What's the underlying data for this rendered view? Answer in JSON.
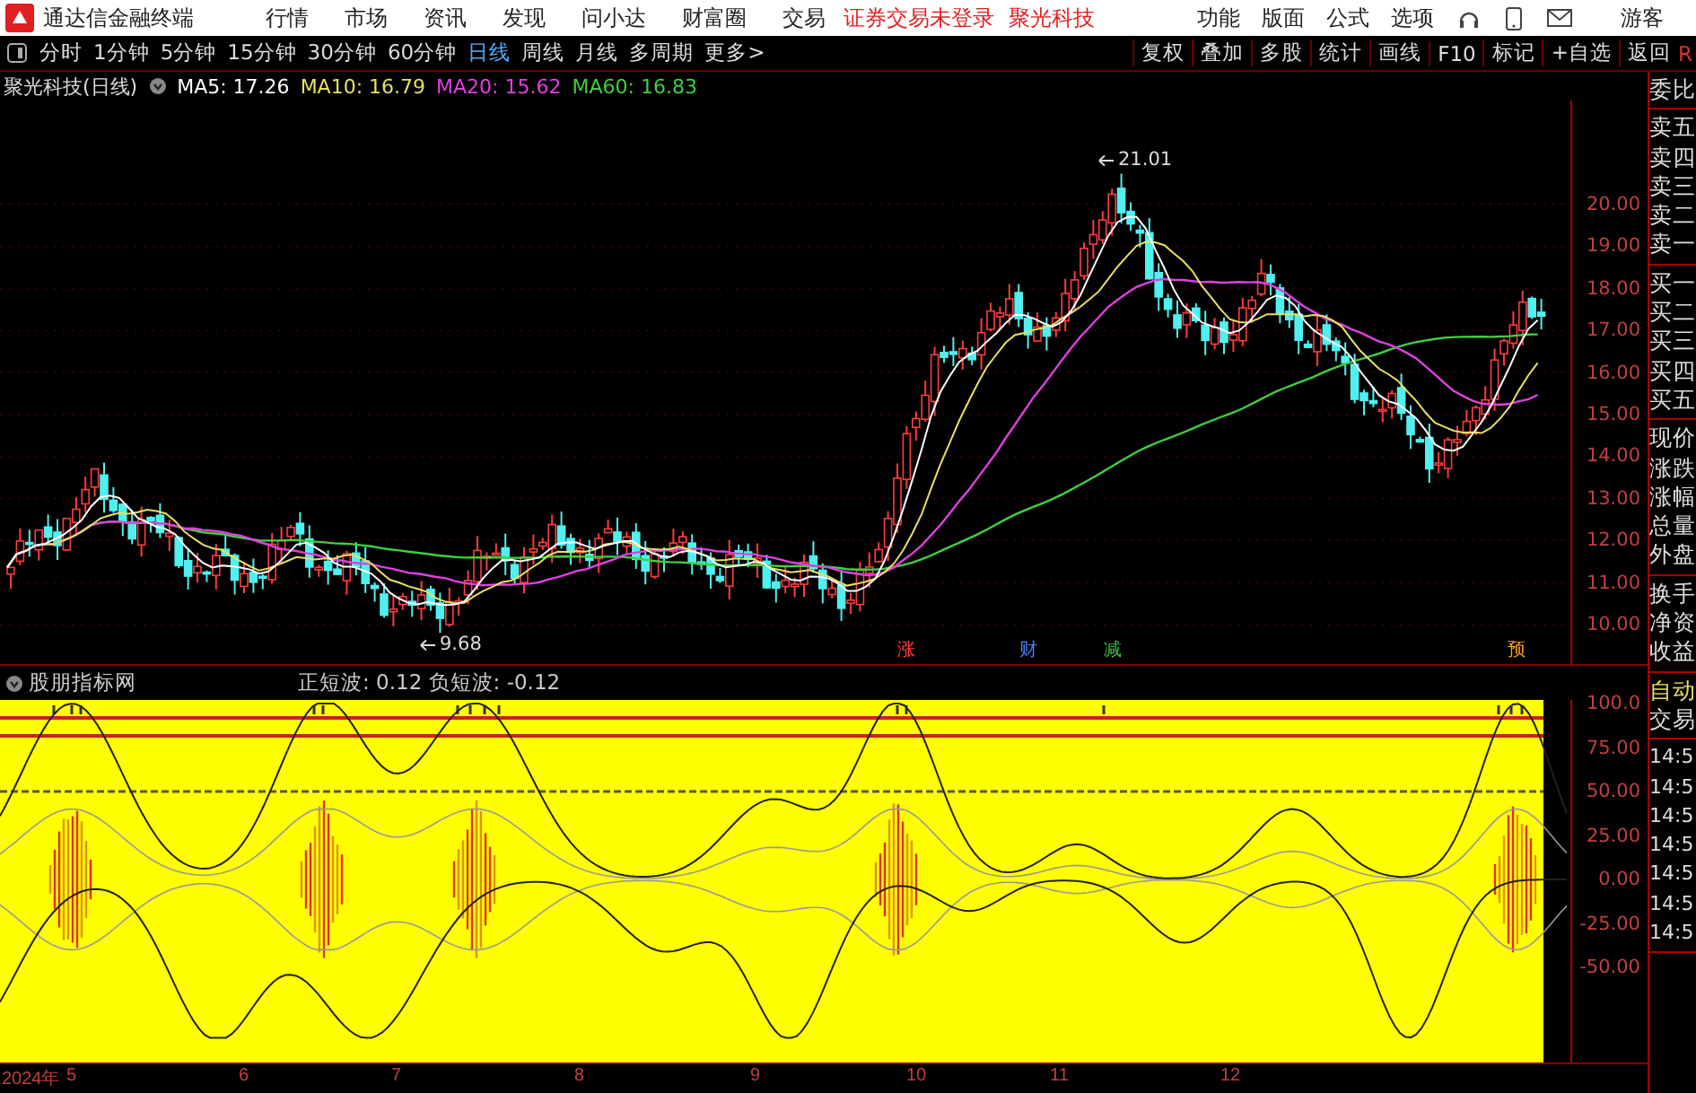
{
  "menu_bar": {
    "app_title": "通达信金融终端",
    "menus": [
      "行情",
      "市场",
      "资讯",
      "发现",
      "问小达",
      "财富圈",
      "交易"
    ],
    "notice": "证券交易未登录",
    "stock": "聚光科技",
    "tools": [
      "功能",
      "版面",
      "公式",
      "选项"
    ],
    "user": "游客"
  },
  "toolbar": {
    "periods": [
      {
        "label": "分时",
        "selected": false
      },
      {
        "label": "1分钟",
        "selected": false
      },
      {
        "label": "5分钟",
        "selected": false
      },
      {
        "label": "15分钟",
        "selected": false
      },
      {
        "label": "30分钟",
        "selected": false
      },
      {
        "label": "60分钟",
        "selected": false
      },
      {
        "label": "日线",
        "selected": true
      },
      {
        "label": "周线",
        "selected": false
      },
      {
        "label": "月线",
        "selected": false
      },
      {
        "label": "多周期",
        "selected": false
      },
      {
        "label": "更多>",
        "selected": false
      }
    ],
    "actions": [
      "复权",
      "叠加",
      "多股",
      "统计",
      "画线",
      "F10",
      "标记",
      "+自选",
      "返回"
    ],
    "edge_label": "R"
  },
  "main_chart": {
    "title": "聚光科技(日线)",
    "averages": [
      {
        "label": "MA5: 17.26",
        "color": "#ffffff"
      },
      {
        "label": "MA10: 16.79",
        "color": "#e8e060"
      },
      {
        "label": "MA20: 15.62",
        "color": "#e040e0"
      },
      {
        "label": "MA60: 16.83",
        "color": "#40d040"
      }
    ],
    "high_label": "21.01",
    "low_label": "9.68",
    "events": [
      {
        "label": "涨",
        "color": "#ff4040"
      },
      {
        "label": "财",
        "color": "#5080ff"
      },
      {
        "label": "减",
        "color": "#40c040"
      },
      {
        "label": "预",
        "color": "#ffa020"
      }
    ],
    "price_ticks": [
      "20.00",
      "19.00",
      "18.00",
      "17.00",
      "16.00",
      "15.00",
      "14.00",
      "13.00",
      "12.00",
      "11.00",
      "10.00"
    ]
  },
  "indicator": {
    "name": "股朋指标网",
    "reading": "正短波: 0.12 负短波: -0.12",
    "ticks": [
      "100.0",
      "75.00",
      "50.00",
      "25.00",
      "0.00",
      "-25.00",
      "-50.00"
    ]
  },
  "date_axis": {
    "labels": [
      "2024年",
      "5",
      "6",
      "7",
      "8",
      "9",
      "10",
      "11",
      "12"
    ]
  },
  "side_panel": {
    "groups": [
      [
        "委比"
      ],
      [
        "卖五",
        "卖四",
        "卖三",
        "卖二",
        "卖一"
      ],
      [
        "买一",
        "买二",
        "买三",
        "买四",
        "买五"
      ],
      [
        "现价",
        "涨跌",
        "涨幅",
        "总量",
        "外盘"
      ],
      [
        "换手",
        "净资",
        "收益"
      ]
    ],
    "trade_tabs": [
      {
        "label": "自动",
        "selected": true
      },
      {
        "label": "交易",
        "selected": false
      }
    ],
    "times": [
      "14:5",
      "14:5",
      "14:5",
      "14:5",
      "14:5",
      "14:5",
      "14:5"
    ]
  }
}
